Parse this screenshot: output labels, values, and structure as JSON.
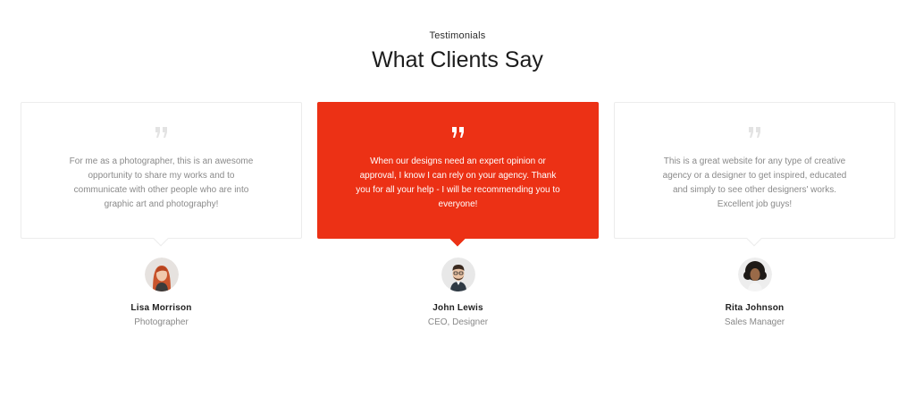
{
  "section": {
    "eyebrow": "Testimonials",
    "title": "What Clients Say"
  },
  "colors": {
    "accent": "#ec3115",
    "card_border": "#ececec",
    "muted_text": "#8a8a8a"
  },
  "testimonials": [
    {
      "quote_icon": "quote-icon",
      "text": "For me as a photographer, this is an awesome opportunity to share my works and to communicate with other people who are into graphic art and photography!",
      "name": "Lisa Morrison",
      "role": "Photographer",
      "highlighted": false
    },
    {
      "quote_icon": "quote-icon",
      "text": "When our designs need an expert opinion or approval, I know I can rely on your agency. Thank you for all your help - I will be recommending you to everyone!",
      "name": "John Lewis",
      "role": "CEO, Designer",
      "highlighted": true
    },
    {
      "quote_icon": "quote-icon",
      "text": "This is a great website for any type of creative agency or a designer to get inspired, educated and simply to see other designers' works. Excellent job guys!",
      "name": "Rita Johnson",
      "role": "Sales Manager",
      "highlighted": false
    }
  ]
}
